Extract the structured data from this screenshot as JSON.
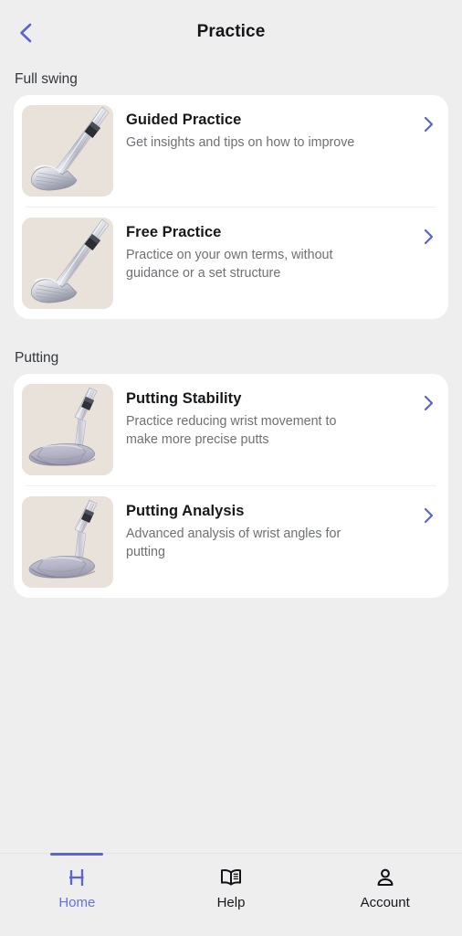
{
  "header": {
    "title": "Practice",
    "back_icon": "chevron-left-icon"
  },
  "colors": {
    "accent": "#5b63d3",
    "accent_light": "#6670e0",
    "page_bg": "#eeeeef",
    "card_bg": "#ffffff",
    "thumb_bg": "#e8e2da",
    "title_text": "#16181c",
    "sub_text": "#6e7076"
  },
  "sections": [
    {
      "title": "Full swing",
      "items": [
        {
          "title": "Guided Practice",
          "subtitle": "Get insights and tips on how to improve",
          "thumb": "golf-iron-image",
          "chevron": "chevron-right-icon"
        },
        {
          "title": "Free Practice",
          "subtitle": "Practice on your own terms, without guidance or a set structure",
          "thumb": "golf-iron-image",
          "chevron": "chevron-right-icon"
        }
      ]
    },
    {
      "title": "Putting",
      "items": [
        {
          "title": "Putting Stability",
          "subtitle": "Practice reducing wrist movement to make more precise putts",
          "thumb": "golf-putter-image",
          "chevron": "chevron-right-icon"
        },
        {
          "title": "Putting Analysis",
          "subtitle": "Advanced analysis of wrist angles for putting",
          "thumb": "golf-putter-image",
          "chevron": "chevron-right-icon"
        }
      ]
    }
  ],
  "tabbar": {
    "items": [
      {
        "label": "Home",
        "icon": "home-h-logo-icon",
        "active": true
      },
      {
        "label": "Help",
        "icon": "book-icon",
        "active": false
      },
      {
        "label": "Account",
        "icon": "person-icon",
        "active": false
      }
    ]
  }
}
